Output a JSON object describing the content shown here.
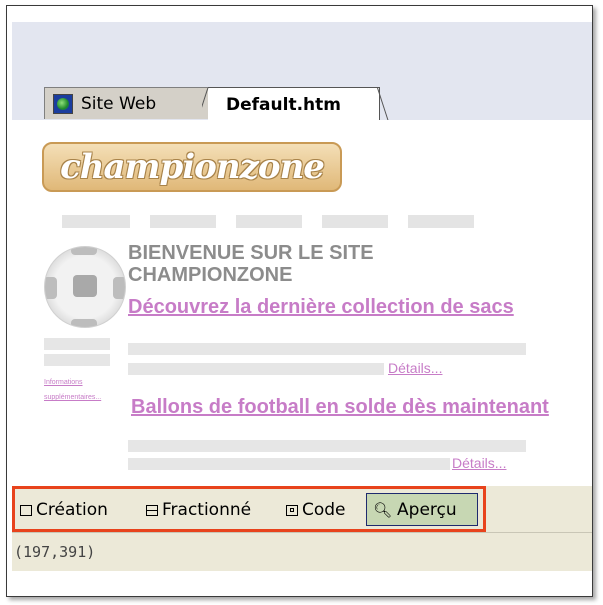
{
  "tabs": [
    {
      "label": "Site Web"
    },
    {
      "label": "Default.htm"
    }
  ],
  "page": {
    "logo_text": "championzone",
    "welcome_line1": "BIENVENUE SUR LE SITE",
    "welcome_line2": "CHAMPIONZONE",
    "promo1_title": "Découvrez la dernière collection de sacs",
    "promo1_link": "Détails...",
    "sidebar_link1": "Informations",
    "sidebar_link2": "supplémentaires...",
    "promo2_title": "Ballons de football en solde dès maintenant",
    "promo2_link": "Détails..."
  },
  "view_buttons": [
    {
      "label": "Création",
      "icon": "design-view-icon"
    },
    {
      "label": "Fractionné",
      "icon": "split-view-icon"
    },
    {
      "label": "Code",
      "icon": "code-view-icon"
    },
    {
      "label": "Aperçu",
      "icon": "preview-magnifier-icon",
      "selected": true
    }
  ],
  "status": {
    "coordinates": "(197,391)"
  },
  "colors": {
    "link": "#c77cc7",
    "highlight_border": "#e8431c",
    "selected_button": "#c7d7b3"
  }
}
